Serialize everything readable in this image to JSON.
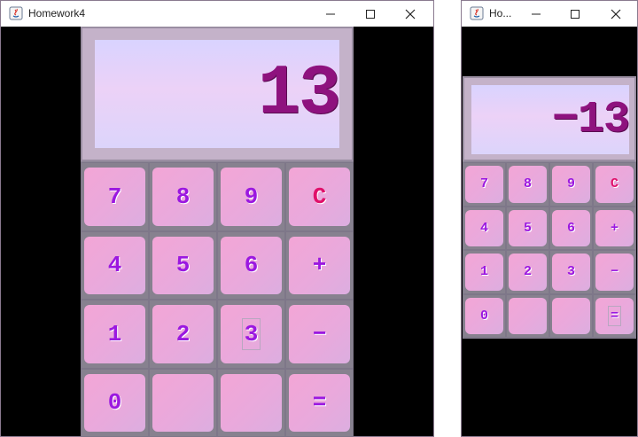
{
  "colors": {
    "display_text": "#8e127e",
    "key_text": "#9b18e0",
    "clear_text": "#e0106a",
    "key_bg": "#f3a6d6",
    "panel_bg": "#8c8696",
    "window_bg": "#000000"
  },
  "windows": [
    {
      "title": "Homework4",
      "app_icon": "java-icon",
      "display": "13",
      "keys": [
        "7",
        "8",
        "9",
        "C",
        "4",
        "5",
        "6",
        "+",
        "1",
        "2",
        "3",
        "−",
        "0",
        "",
        "",
        "="
      ]
    },
    {
      "title": "Ho...",
      "app_icon": "java-icon",
      "display": "−13",
      "keys": [
        "7",
        "8",
        "9",
        "C",
        "4",
        "5",
        "6",
        "+",
        "1",
        "2",
        "3",
        "−",
        "0",
        "",
        "",
        "="
      ]
    }
  ]
}
